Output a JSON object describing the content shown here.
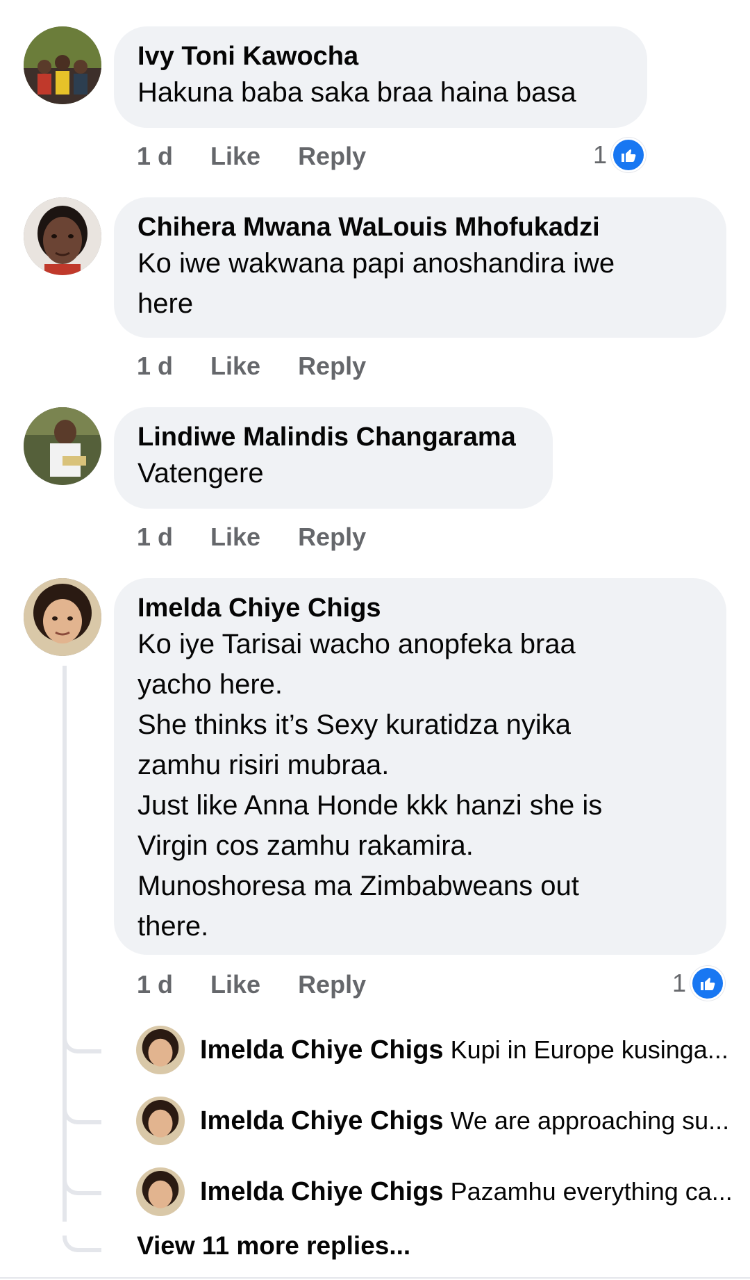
{
  "comments": [
    {
      "author": "Ivy Toni Kawocha",
      "text": "Hakuna baba saka braa haina basa",
      "time": "1 d",
      "like": "Like",
      "reply": "Reply",
      "reactions": "1"
    },
    {
      "author": "Chihera Mwana WaLouis Mhofukadzi",
      "text": "Ko iwe wakwana papi anoshandira iwe\nhere",
      "time": "1 d",
      "like": "Like",
      "reply": "Reply"
    },
    {
      "author": "Lindiwe Malindis Changarama",
      "text": "Vatengere",
      "time": "1 d",
      "like": "Like",
      "reply": "Reply"
    },
    {
      "author": "Imelda Chiye Chigs",
      "text": "Ko iye Tarisai wacho anopfeka braa\nyacho here.\nShe thinks it’s Sexy kuratidza nyika\nzamhu risiri mubraa.\nJust like Anna Honde kkk hanzi she is\nVirgin cos zamhu rakamira.\nMunoshoresa ma Zimbabweans out\nthere.",
      "time": "1 d",
      "like": "Like",
      "reply": "Reply",
      "reactions": "1",
      "replies": [
        {
          "author": "Imelda Chiye Chigs",
          "text": "Kupi in Europe kusinga..."
        },
        {
          "author": "Imelda Chiye Chigs",
          "text": "We are approaching su..."
        },
        {
          "author": "Imelda Chiye Chigs",
          "text": "Pazamhu everything ca..."
        }
      ],
      "view_more": "View 11 more replies..."
    }
  ],
  "icons": {
    "like_badge": "thumbs-up-icon"
  },
  "colors": {
    "bubble": "#f0f2f5",
    "meta": "#65676b",
    "like_blue": "#1877f2",
    "thread": "#e4e6eb"
  }
}
